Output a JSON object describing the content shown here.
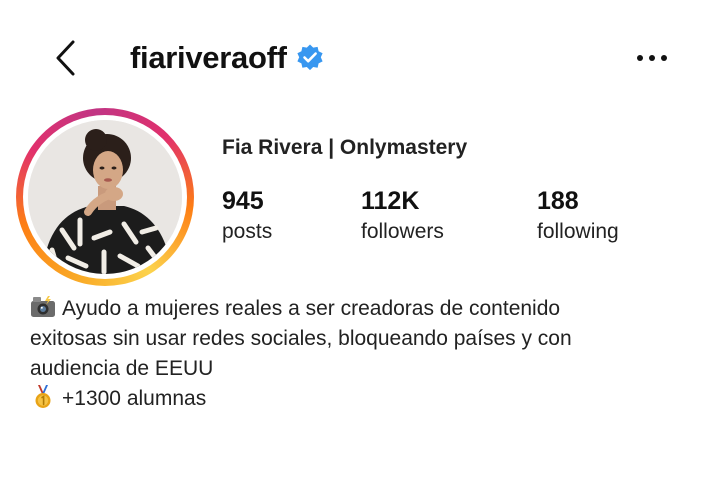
{
  "header": {
    "username": "fiariveraoff",
    "verified_color": "#3897f0"
  },
  "profile": {
    "display_name": "Fia Rivera | Onlymastery",
    "avatar_icon": "profile-photo",
    "stats": [
      {
        "value": "945",
        "label": "posts"
      },
      {
        "value": "112K",
        "label": "followers"
      },
      {
        "value": "188",
        "label": "following"
      }
    ]
  },
  "bio": {
    "lines": [
      {
        "icon": "camera-flash-icon",
        "text": "Ayudo a mujeres reales a ser creadoras de contenido"
      },
      {
        "text": "exitosas sin usar redes sociales, bloqueando países y con"
      },
      {
        "text": "audiencia de EEUU"
      },
      {
        "icon": "medal-icon",
        "text": "+1300 alumnas"
      }
    ]
  }
}
